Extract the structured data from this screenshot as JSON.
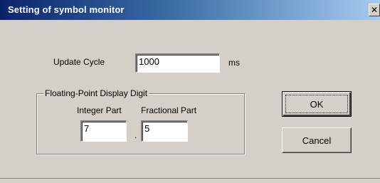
{
  "window": {
    "title": "Setting of symbol monitor",
    "close_glyph": "✕"
  },
  "update_cycle": {
    "label": "Update Cycle",
    "value": "1000",
    "unit": "ms"
  },
  "display_digit": {
    "group_label": "Floating-Point Display Digit",
    "integer_label": "Integer Part",
    "integer_value": "7",
    "separator": ".",
    "fractional_label": "Fractional Part",
    "fractional_value": "5"
  },
  "buttons": {
    "ok": "OK",
    "cancel": "Cancel"
  }
}
